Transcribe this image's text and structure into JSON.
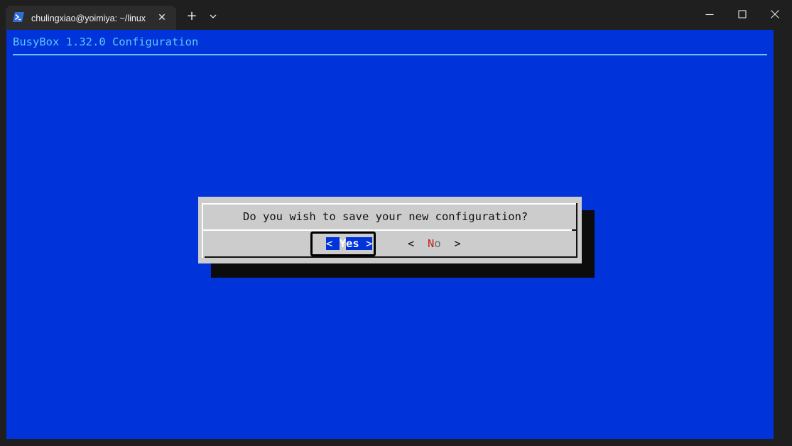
{
  "window": {
    "tab_title": "chulingxiao@yoimiya: ~/linux",
    "tab_close": "✕",
    "new_tab": "+",
    "icons": {
      "tab": "powershell-icon",
      "dropdown": "chevron-down-icon",
      "minimize": "minimize-icon",
      "maximize": "maximize-icon",
      "close": "close-icon"
    }
  },
  "terminal": {
    "backtitle": "BusyBox 1.32.0 Configuration",
    "colors": {
      "background": "#0033d9",
      "backtitle": "#5fc8f6",
      "dialog": "#cccccc",
      "hotkey": "#c81e1e"
    }
  },
  "dialog": {
    "message": "Do you wish to save your new configuration?",
    "buttons": {
      "yes": {
        "left_bracket": "<",
        "hotkey": "Y",
        "rest": "es",
        "right_bracket": ">",
        "selected": true
      },
      "no": {
        "left_bracket": "<",
        "hotkey": "N",
        "rest": "o",
        "right_bracket": ">",
        "selected": false
      }
    }
  }
}
